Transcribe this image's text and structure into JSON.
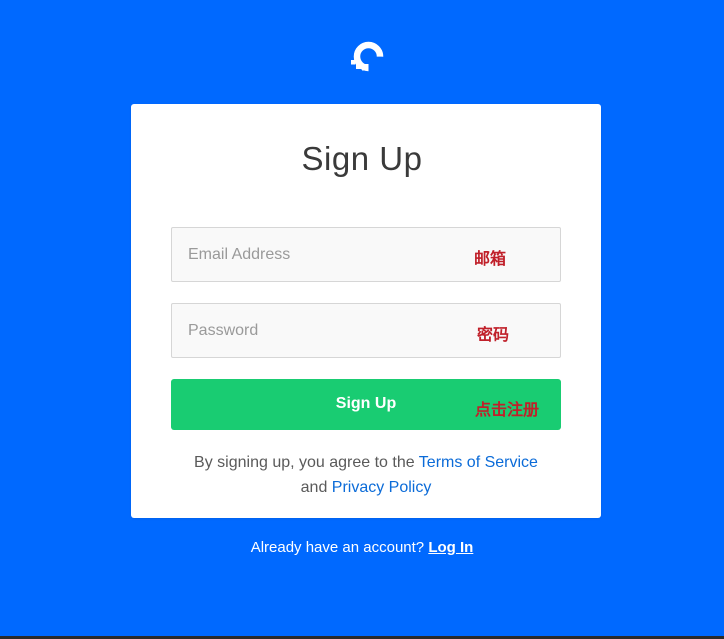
{
  "colors": {
    "background": "#0069ff",
    "card": "#ffffff",
    "button": "#19cc72",
    "link": "#0b6bd8",
    "annotation": "#c0202a"
  },
  "logo": {
    "icon": "digitalocean-logo-icon"
  },
  "form": {
    "title": "Sign Up",
    "email": {
      "placeholder": "Email Address",
      "value": ""
    },
    "password": {
      "placeholder": "Password",
      "value": ""
    },
    "submit_label": "Sign Up"
  },
  "annotations": {
    "email": "邮箱",
    "password": "密码",
    "submit": "点击注册"
  },
  "terms": {
    "prefix": "By signing up, you agree to the ",
    "terms_link": "Terms of Service",
    "connector": " and ",
    "privacy_link": "Privacy Policy"
  },
  "footer": {
    "prompt": "Already have an account? ",
    "login_link": "Log In"
  }
}
